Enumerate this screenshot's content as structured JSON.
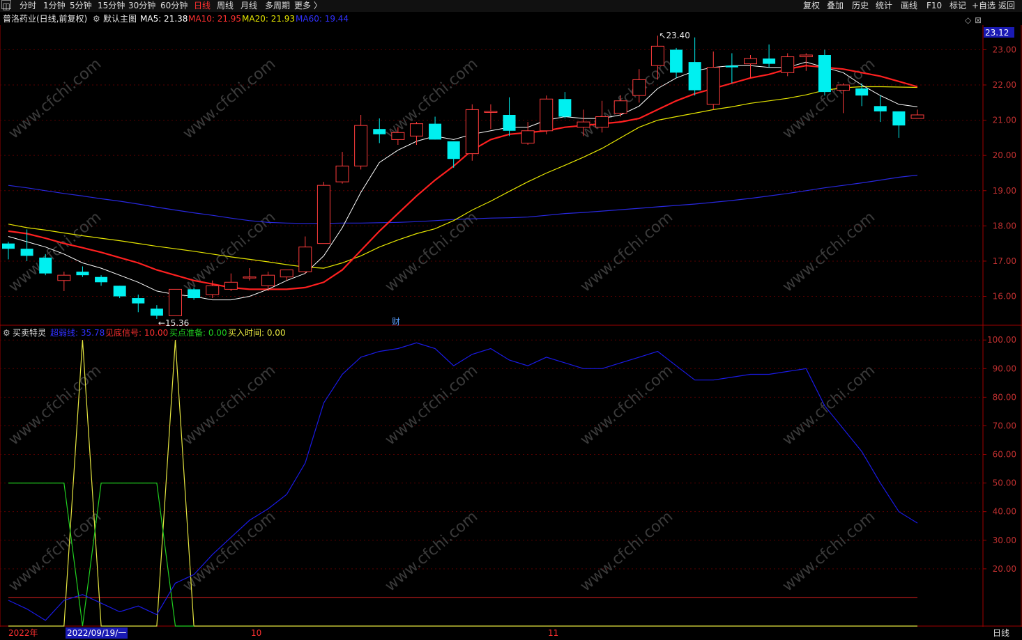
{
  "toolbar": {
    "icon": "chart-menu-icon",
    "periods": [
      "分时",
      "1分钟",
      "5分钟",
      "15分钟",
      "30分钟",
      "60分钟",
      "日线",
      "周线",
      "月线",
      "多周期",
      "更多 〉"
    ],
    "active_period": "日线",
    "right_buttons": [
      "复权",
      "叠加",
      "历史",
      "统计",
      "画线",
      "F10",
      "标记",
      "+自选",
      "返回"
    ]
  },
  "main_header": {
    "stock": "普洛药业(日线,前复权)",
    "template": "默认主图",
    "ma5_label": "MA5: 21.38",
    "ma10_label": "MA10: 21.95",
    "ma20_label": "MA20: 21.93",
    "ma60_label": "MA60: 19.44"
  },
  "indicator_header": {
    "name": "买卖特灵",
    "line1": "超弱线: 35.78",
    "line2": "见底信号: 10.00",
    "line3": "买点准备: 0.00",
    "line4": "买入时间: 0.00"
  },
  "colors": {
    "up": "#ff3c3c",
    "down": "#00f0f0",
    "ma5": "#ffffff",
    "ma10": "#ff2020",
    "ma20": "#e6e600",
    "ma60": "#2828e0",
    "axis": "#a00000",
    "grid": "#5a0000",
    "blue_line": "#1a1ae6",
    "green_line": "#20d020",
    "yellow_line": "#e6e640",
    "red_line": "#e02020"
  },
  "price_label_box": "23.12",
  "high_label": "23.40",
  "low_label": "15.36",
  "finance_marker": "财",
  "bottom": {
    "year": "2022年",
    "cursor_date": "2022/09/19/一",
    "month1": "10",
    "month2": "11",
    "period": "日线"
  },
  "watermark": "www.cfchi.com",
  "chart_data": [
    {
      "type": "candlestick",
      "title": "普洛药业(日线,前复权)",
      "y_ticks": [
        16.0,
        17.0,
        18.0,
        19.0,
        20.0,
        21.0,
        22.0,
        23.0
      ],
      "ylim": [
        15.2,
        23.7
      ],
      "candles": [
        {
          "o": 17.5,
          "c": 17.35,
          "h": 17.55,
          "l": 17.05
        },
        {
          "o": 17.35,
          "c": 17.15,
          "h": 17.9,
          "l": 17.0
        },
        {
          "o": 17.1,
          "c": 16.65,
          "h": 17.2,
          "l": 16.6
        },
        {
          "o": 16.45,
          "c": 16.6,
          "h": 16.7,
          "l": 16.15
        },
        {
          "o": 16.7,
          "c": 16.6,
          "h": 16.85,
          "l": 16.55
        },
        {
          "o": 16.55,
          "c": 16.4,
          "h": 16.6,
          "l": 16.3
        },
        {
          "o": 16.3,
          "c": 16.0,
          "h": 16.3,
          "l": 15.95
        },
        {
          "o": 15.95,
          "c": 15.8,
          "h": 16.05,
          "l": 15.55
        },
        {
          "o": 15.65,
          "c": 15.45,
          "h": 15.75,
          "l": 15.36
        },
        {
          "o": 15.45,
          "c": 16.2,
          "h": 16.2,
          "l": 15.45
        },
        {
          "o": 16.2,
          "c": 15.95,
          "h": 16.25,
          "l": 15.9
        },
        {
          "o": 16.05,
          "c": 16.3,
          "h": 16.45,
          "l": 15.95
        },
        {
          "o": 16.2,
          "c": 16.4,
          "h": 16.65,
          "l": 16.15
        },
        {
          "o": 16.55,
          "c": 16.55,
          "h": 16.8,
          "l": 16.45
        },
        {
          "o": 16.3,
          "c": 16.6,
          "h": 16.7,
          "l": 16.15
        },
        {
          "o": 16.55,
          "c": 16.75,
          "h": 16.75,
          "l": 16.45
        },
        {
          "o": 16.7,
          "c": 17.4,
          "h": 17.7,
          "l": 16.65
        },
        {
          "o": 17.5,
          "c": 19.15,
          "h": 19.25,
          "l": 17.5
        },
        {
          "o": 19.25,
          "c": 19.7,
          "h": 20.1,
          "l": 19.2
        },
        {
          "o": 19.7,
          "c": 20.85,
          "h": 21.15,
          "l": 19.6
        },
        {
          "o": 20.75,
          "c": 20.6,
          "h": 21.05,
          "l": 20.35
        },
        {
          "o": 20.45,
          "c": 20.65,
          "h": 20.8,
          "l": 20.3
        },
        {
          "o": 20.55,
          "c": 20.9,
          "h": 20.95,
          "l": 20.3
        },
        {
          "o": 20.9,
          "c": 20.45,
          "h": 21.1,
          "l": 20.45
        },
        {
          "o": 20.4,
          "c": 19.9,
          "h": 20.4,
          "l": 19.65
        },
        {
          "o": 20.05,
          "c": 21.3,
          "h": 21.45,
          "l": 19.85
        },
        {
          "o": 21.25,
          "c": 21.25,
          "h": 21.45,
          "l": 20.75
        },
        {
          "o": 21.15,
          "c": 20.7,
          "h": 21.65,
          "l": 20.55
        },
        {
          "o": 20.35,
          "c": 20.7,
          "h": 20.95,
          "l": 20.3
        },
        {
          "o": 20.7,
          "c": 21.6,
          "h": 21.7,
          "l": 20.6
        },
        {
          "o": 21.6,
          "c": 21.1,
          "h": 21.8,
          "l": 21.05
        },
        {
          "o": 20.8,
          "c": 20.95,
          "h": 21.3,
          "l": 20.55
        },
        {
          "o": 20.8,
          "c": 21.1,
          "h": 21.55,
          "l": 20.65
        },
        {
          "o": 21.2,
          "c": 21.55,
          "h": 21.7,
          "l": 21.1
        },
        {
          "o": 21.7,
          "c": 22.15,
          "h": 22.45,
          "l": 21.5
        },
        {
          "o": 22.55,
          "c": 23.1,
          "h": 23.4,
          "l": 22.15
        },
        {
          "o": 23.0,
          "c": 22.35,
          "h": 23.05,
          "l": 22.2
        },
        {
          "o": 22.65,
          "c": 21.85,
          "h": 23.35,
          "l": 21.7
        },
        {
          "o": 21.45,
          "c": 22.5,
          "h": 22.95,
          "l": 21.3
        },
        {
          "o": 22.55,
          "c": 22.5,
          "h": 22.9,
          "l": 22.05
        },
        {
          "o": 22.6,
          "c": 22.75,
          "h": 22.85,
          "l": 22.2
        },
        {
          "o": 22.75,
          "c": 22.6,
          "h": 23.15,
          "l": 22.5
        },
        {
          "o": 22.35,
          "c": 22.8,
          "h": 22.9,
          "l": 22.25
        },
        {
          "o": 22.8,
          "c": 22.85,
          "h": 22.9,
          "l": 22.4
        },
        {
          "o": 22.85,
          "c": 21.8,
          "h": 23.0,
          "l": 21.7
        },
        {
          "o": 21.85,
          "c": 22.0,
          "h": 22.05,
          "l": 21.2
        },
        {
          "o": 21.9,
          "c": 21.7,
          "h": 22.05,
          "l": 21.4
        },
        {
          "o": 21.4,
          "c": 21.25,
          "h": 21.7,
          "l": 20.95
        },
        {
          "o": 21.25,
          "c": 20.85,
          "h": 21.25,
          "l": 20.5
        },
        {
          "o": 21.05,
          "c": 21.15,
          "h": 21.3,
          "l": 21.05
        }
      ],
      "ma5": [
        17.7,
        17.55,
        17.4,
        17.2,
        16.95,
        16.8,
        16.6,
        16.4,
        16.15,
        16.05,
        16.0,
        15.9,
        15.9,
        16.0,
        16.2,
        16.45,
        16.65,
        17.15,
        17.95,
        18.95,
        19.8,
        20.15,
        20.4,
        20.55,
        20.45,
        20.6,
        20.7,
        20.8,
        20.8,
        21.0,
        21.1,
        21.05,
        21.05,
        21.15,
        21.4,
        21.9,
        22.2,
        22.4,
        22.5,
        22.55,
        22.55,
        22.5,
        22.5,
        22.65,
        22.5,
        22.35,
        22.0,
        21.7,
        21.45,
        21.38
      ],
      "ma10": [
        17.85,
        17.78,
        17.65,
        17.5,
        17.38,
        17.25,
        17.1,
        16.95,
        16.75,
        16.6,
        16.45,
        16.35,
        16.25,
        16.2,
        16.2,
        16.2,
        16.25,
        16.4,
        16.75,
        17.3,
        17.85,
        18.35,
        18.85,
        19.3,
        19.7,
        20.15,
        20.45,
        20.6,
        20.65,
        20.7,
        20.8,
        20.85,
        20.9,
        20.95,
        21.05,
        21.3,
        21.55,
        21.75,
        21.9,
        22.05,
        22.2,
        22.3,
        22.45,
        22.55,
        22.5,
        22.45,
        22.35,
        22.25,
        22.1,
        21.95
      ],
      "ma20": [
        18.05,
        17.95,
        17.88,
        17.8,
        17.72,
        17.65,
        17.58,
        17.5,
        17.42,
        17.35,
        17.28,
        17.2,
        17.12,
        17.05,
        16.98,
        16.9,
        16.83,
        16.8,
        16.95,
        17.15,
        17.4,
        17.6,
        17.78,
        17.92,
        18.15,
        18.45,
        18.7,
        18.98,
        19.25,
        19.5,
        19.72,
        19.95,
        20.2,
        20.5,
        20.8,
        21.0,
        21.1,
        21.2,
        21.3,
        21.38,
        21.48,
        21.55,
        21.62,
        21.72,
        21.85,
        21.92,
        21.95,
        21.95,
        21.94,
        21.93
      ],
      "ma60": [
        19.15,
        19.08,
        19.0,
        18.92,
        18.85,
        18.77,
        18.7,
        18.62,
        18.53,
        18.45,
        18.37,
        18.3,
        18.22,
        18.15,
        18.1,
        18.08,
        18.07,
        18.07,
        18.08,
        18.08,
        18.09,
        18.1,
        18.12,
        18.15,
        18.18,
        18.2,
        18.22,
        18.23,
        18.25,
        18.3,
        18.35,
        18.38,
        18.42,
        18.46,
        18.5,
        18.54,
        18.58,
        18.62,
        18.67,
        18.72,
        18.78,
        18.85,
        18.92,
        19.0,
        19.08,
        19.15,
        19.22,
        19.3,
        19.38,
        19.44
      ]
    },
    {
      "type": "line",
      "title": "买卖特灵",
      "y_ticks": [
        20.0,
        30.0,
        40.0,
        50.0,
        60.0,
        70.0,
        80.0,
        90.0,
        100.0
      ],
      "ylim": [
        0,
        102
      ],
      "series": [
        {
          "name": "超弱线",
          "values": [
            9,
            6,
            2,
            9,
            11,
            8,
            5,
            7,
            4,
            15,
            18,
            25,
            31,
            37,
            41,
            46,
            57,
            78,
            88,
            94,
            96,
            97,
            99,
            97,
            91,
            95,
            97,
            93,
            91,
            94,
            92,
            90,
            90,
            92,
            94,
            96,
            91,
            86,
            86,
            87,
            88,
            88,
            89,
            90,
            77,
            69,
            61,
            50,
            40,
            36
          ]
        },
        {
          "name": "见底信号",
          "values": [
            10,
            10,
            10,
            10,
            10,
            10,
            10,
            10,
            10,
            10,
            10,
            10,
            10,
            10,
            10,
            10,
            10,
            10,
            10,
            10,
            10,
            10,
            10,
            10,
            10,
            10,
            10,
            10,
            10,
            10,
            10,
            10,
            10,
            10,
            10,
            10,
            10,
            10,
            10,
            10,
            10,
            10,
            10,
            10,
            10,
            10,
            10,
            10,
            10,
            10
          ]
        },
        {
          "name": "买点准备",
          "values": [
            50,
            50,
            50,
            50,
            0,
            50,
            50,
            50,
            50,
            0,
            0
          ]
        },
        {
          "name": "买入时间",
          "values": [
            0,
            0,
            0,
            0,
            100,
            0,
            0,
            0,
            0,
            100,
            0,
            0,
            0,
            0,
            0,
            0,
            0,
            0,
            0,
            0,
            0,
            0,
            0,
            0,
            0,
            0,
            0,
            0,
            0,
            0,
            0,
            0,
            0,
            0,
            0,
            0,
            0,
            0,
            0,
            0,
            0,
            0,
            0,
            0,
            0,
            0,
            0,
            0,
            0,
            0
          ]
        }
      ]
    }
  ]
}
